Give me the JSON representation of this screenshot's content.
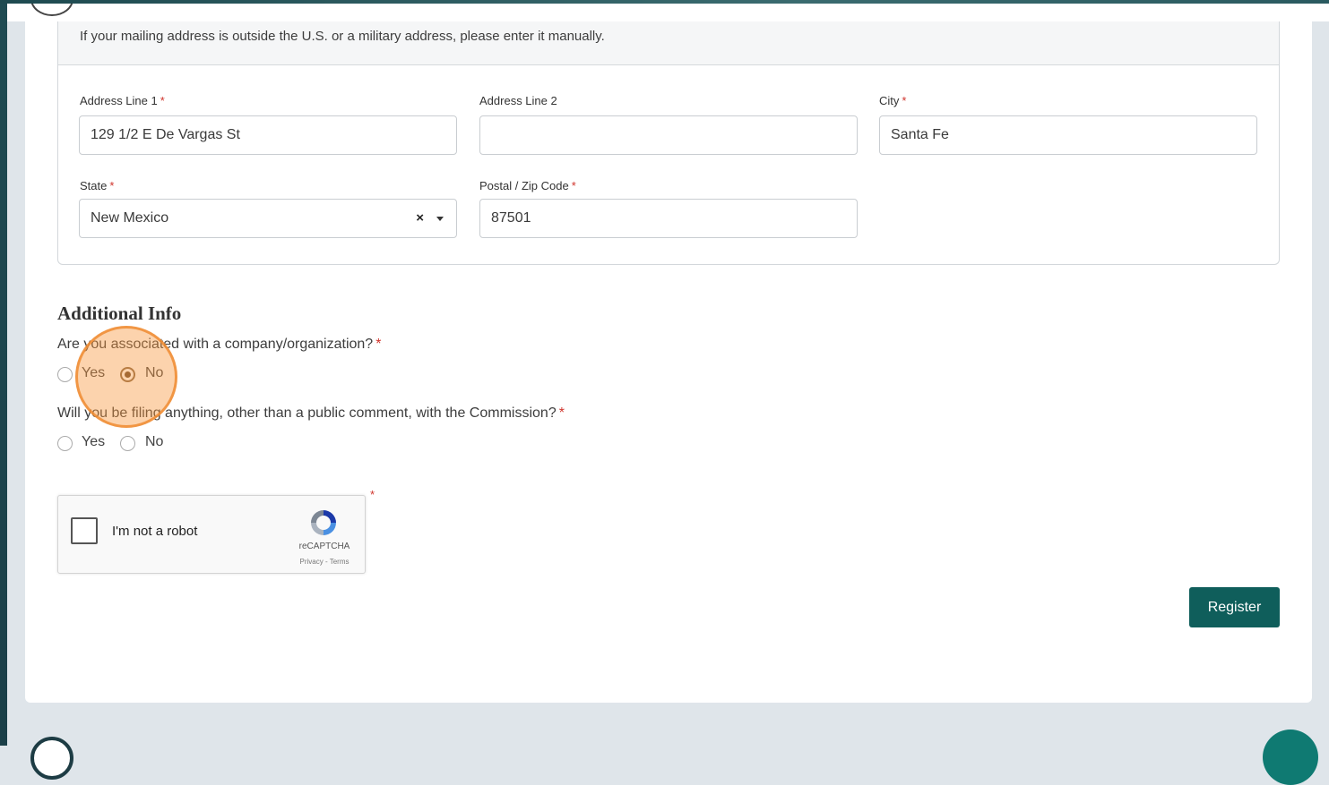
{
  "address": {
    "note": "If your mailing address is outside the U.S. or a military address, please enter it manually.",
    "line1": {
      "label": "Address Line 1",
      "value": "129 1/2 E De Vargas St"
    },
    "line2": {
      "label": "Address Line 2",
      "value": ""
    },
    "city": {
      "label": "City",
      "value": "Santa Fe"
    },
    "state": {
      "label": "State",
      "value": "New Mexico",
      "clear_glyph": "×"
    },
    "zip": {
      "label": "Postal / Zip Code",
      "value": "87501"
    }
  },
  "required_marker": "*",
  "additional_info": {
    "title": "Additional Info",
    "q1": {
      "text": "Are you associated with a company/organization?",
      "yes": "Yes",
      "no": "No",
      "selected": "No"
    },
    "q2": {
      "text": "Will you be filing anything, other than a public comment, with the Commission?",
      "yes": "Yes",
      "no": "No",
      "selected": ""
    }
  },
  "captcha": {
    "label": "I'm not a robot",
    "brand": "reCAPTCHA",
    "links": "Privacy - Terms"
  },
  "register_label": "Register",
  "colors": {
    "primary": "#0f5e5b",
    "required": "#d0342c",
    "highlight": "#f7963c"
  },
  "icons": [
    "recaptcha-logo-icon",
    "clear-icon",
    "caret-down-icon"
  ]
}
